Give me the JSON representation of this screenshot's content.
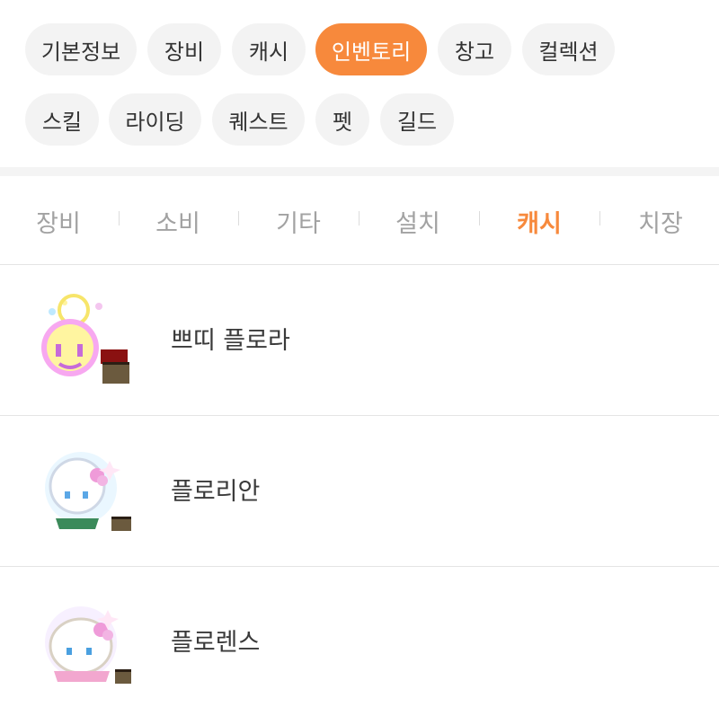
{
  "tabs": [
    {
      "label": "기본정보",
      "active": false
    },
    {
      "label": "장비",
      "active": false
    },
    {
      "label": "캐시",
      "active": false
    },
    {
      "label": "인벤토리",
      "active": true
    },
    {
      "label": "창고",
      "active": false
    },
    {
      "label": "컬렉션",
      "active": false
    },
    {
      "label": "스킬",
      "active": false
    },
    {
      "label": "라이딩",
      "active": false
    },
    {
      "label": "퀘스트",
      "active": false
    },
    {
      "label": "펫",
      "active": false
    },
    {
      "label": "길드",
      "active": false
    }
  ],
  "subtabs": [
    {
      "label": "장비",
      "active": false
    },
    {
      "label": "소비",
      "active": false
    },
    {
      "label": "기타",
      "active": false
    },
    {
      "label": "설치",
      "active": false
    },
    {
      "label": "캐시",
      "active": true
    },
    {
      "label": "치장",
      "active": false
    }
  ],
  "items": [
    {
      "name": "쁘띠 플로라",
      "icon": "petit-flora-icon"
    },
    {
      "name": "플로리안",
      "icon": "florian-icon"
    },
    {
      "name": "플로렌스",
      "icon": "florence-icon"
    }
  ],
  "colors": {
    "accent": "#f7893c",
    "chip_bg": "#f3f3f3",
    "muted": "#a2a2a2"
  }
}
